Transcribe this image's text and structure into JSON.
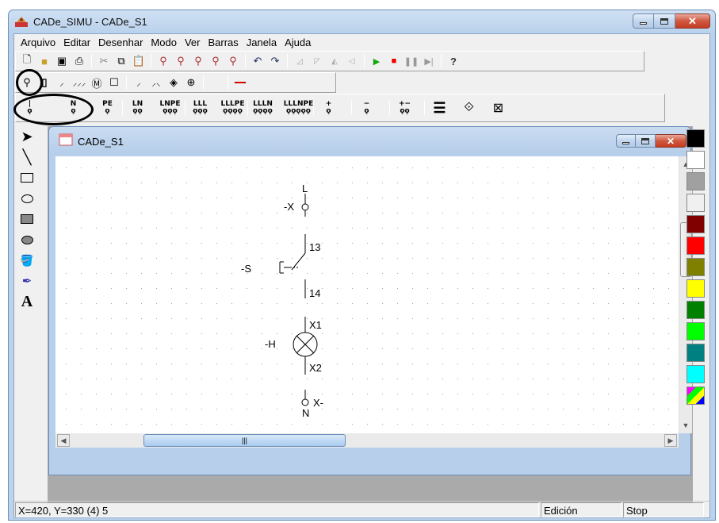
{
  "window": {
    "title": "CADe_SIMU - CADe_S1"
  },
  "menu": [
    "Arquivo",
    "Editar",
    "Desenhar",
    "Modo",
    "Ver",
    "Barras",
    "Janela",
    "Ajuda"
  ],
  "toolbar3": {
    "pe_label": "PE",
    "n_label": "N",
    "ln_label": "LN",
    "lnpe_label": "LNPE",
    "lll_label": "LLL",
    "lllpe_label": "LLLPE",
    "llln_label": "LLLN",
    "lllnpe_label": "LLLNPE"
  },
  "child": {
    "title": "CADe_S1"
  },
  "schematic": {
    "terminal_top_label": "-X",
    "terminal_top_line": "L",
    "switch_label": "-S",
    "contact_top": "13",
    "contact_bottom": "14",
    "lamp_label": "-H",
    "lamp_top": "X1",
    "lamp_bottom": "X2",
    "terminal_bottom_label": "X-",
    "terminal_bottom_line": "N"
  },
  "status": {
    "coords": "X=420, Y=330 (4) 5",
    "mode": "Edición",
    "run_state": "Stop"
  },
  "palette": [
    "#000000",
    "#ffffff",
    "#a0a0a0",
    "#f0f0f0",
    "#800000",
    "#ff0000",
    "#808000",
    "#ffff00",
    "#008000",
    "#00ff00",
    "#008080",
    "#00ffff",
    "multicolor"
  ]
}
